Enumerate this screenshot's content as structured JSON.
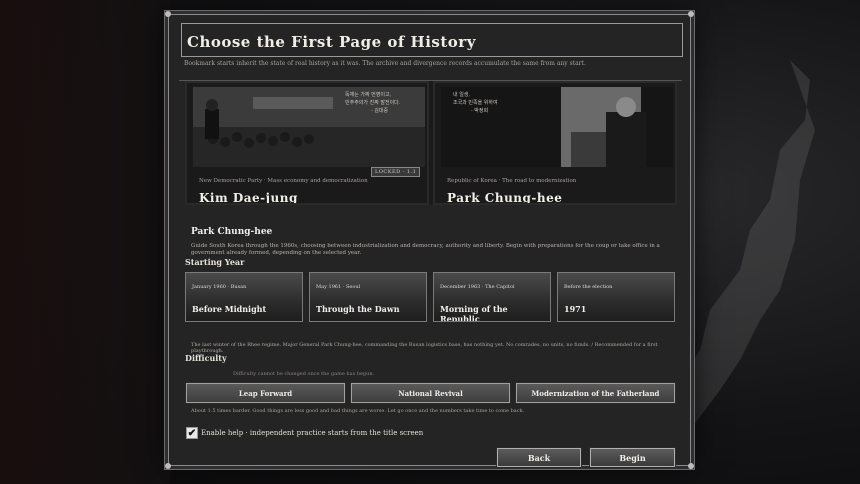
{
  "dialog": {
    "title": "Choose the First Page of History",
    "subtitle": "Bookmark starts inherit the state of real history as it was. The archive and divergence records accumulate the same from any start."
  },
  "leaders": [
    {
      "caption": "New Democratic Party · Mass economy and democratization",
      "name": "Kim Dae-jung",
      "quote": [
        "독재는 가짜 번영이고,",
        "민주주의가 진짜 발전이다.",
        "- 김대중"
      ],
      "status": "LOCKED · 1.1",
      "locked": true
    },
    {
      "caption": "Republic of Korea · The road to modernization",
      "name": "Park Chung-hee",
      "quote": [
        "내 일생,",
        "조국과 민족을 위하여",
        "- 박정희"
      ],
      "locked": false
    }
  ],
  "selected": {
    "name": "Park Chung-hee",
    "description": "Guide South Korea through the 1960s, choosing between industrialization and democracy, authority and liberty. Begin with preparations for the coup or take office in a government already formed, depending on the selected year."
  },
  "starting_year": {
    "label": "Starting Year",
    "options": [
      {
        "date": "January 1960 · Busan",
        "name": "Before Midnight"
      },
      {
        "date": "May 1961 · Seoul",
        "name": "Through the Dawn"
      },
      {
        "date": "December 1963 · The Capitol",
        "name": "Morning of the Republic"
      },
      {
        "date": "Before the election",
        "name": "1971"
      }
    ],
    "note": "The last winter of the Rhee regime. Major General Park Chung-hee, commanding the Busan logistics base, has nothing yet. No comrades, no units, no funds. / Recommended for a first playthrough."
  },
  "difficulty": {
    "label": "Difficulty",
    "note": "Difficulty cannot be changed once the game has begun.",
    "options": [
      "Leap Forward",
      "National Revival",
      "Modernization of the Fatherland"
    ],
    "selected_description": "About 1.5 times harder. Good things are less good and bad things are worse. Let go once and the numbers take time to come back."
  },
  "help": {
    "checked": true,
    "check_mark": "✔",
    "label": "Enable help · independent practice starts from the title screen"
  },
  "buttons": {
    "back": "Back",
    "begin": "Begin"
  }
}
